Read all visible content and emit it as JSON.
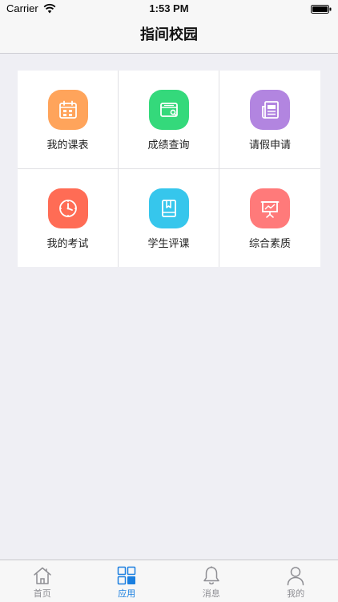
{
  "status_bar": {
    "carrier": "Carrier",
    "time": "1:53 PM"
  },
  "nav": {
    "title": "指间校园"
  },
  "apps": [
    {
      "label": "我的课表",
      "icon": "calendar-icon",
      "color": "#ffa45b"
    },
    {
      "label": "成绩查询",
      "icon": "wallet-icon",
      "color": "#34d97b"
    },
    {
      "label": "请假申请",
      "icon": "document-icon",
      "color": "#b285e0"
    },
    {
      "label": "我的考试",
      "icon": "clock-icon",
      "color": "#ff6c55"
    },
    {
      "label": "学生评课",
      "icon": "book-icon",
      "color": "#36c6ec"
    },
    {
      "label": "综合素质",
      "icon": "presentation-board-icon",
      "color": "#ff7a7a"
    }
  ],
  "tabs": [
    {
      "label": "首页",
      "icon": "home-icon",
      "active": false
    },
    {
      "label": "应用",
      "icon": "apps-grid-icon",
      "active": true
    },
    {
      "label": "消息",
      "icon": "bell-icon",
      "active": false
    },
    {
      "label": "我的",
      "icon": "user-icon",
      "active": false
    }
  ],
  "colors": {
    "accent": "#1a7fe0",
    "tab_inactive": "#8e8e93",
    "background": "#efeff4"
  }
}
